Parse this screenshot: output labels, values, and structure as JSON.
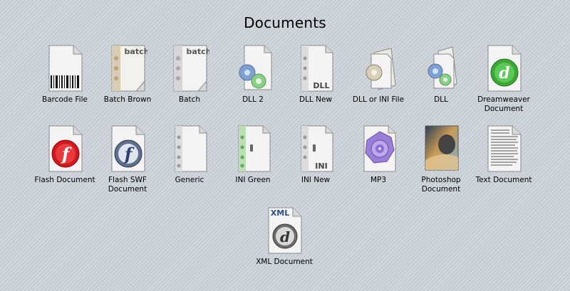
{
  "header": {
    "title": "Documents"
  },
  "icons": [
    {
      "label": "Barcode File",
      "icon": "barcode-file-icon"
    },
    {
      "label": "Batch Brown",
      "icon": "batch-brown-icon",
      "badge": "batch"
    },
    {
      "label": "Batch",
      "icon": "batch-icon",
      "badge": "batch"
    },
    {
      "label": "DLL 2",
      "icon": "dll2-icon"
    },
    {
      "label": "DLL New",
      "icon": "dll-new-icon",
      "badge": "DLL"
    },
    {
      "label": "DLL or INI File",
      "icon": "dll-or-ini-icon"
    },
    {
      "label": "DLL",
      "icon": "dll-icon"
    },
    {
      "label": "Dreamweaver\nDocument",
      "icon": "dreamweaver-icon"
    },
    {
      "label": "Flash Document",
      "icon": "flash-document-icon"
    },
    {
      "label": "Flash SWF\nDocument",
      "icon": "flash-swf-icon"
    },
    {
      "label": "Generic",
      "icon": "generic-icon"
    },
    {
      "label": "INI Green",
      "icon": "ini-green-icon"
    },
    {
      "label": "INI New",
      "icon": "ini-new-icon",
      "badge": "INI"
    },
    {
      "label": "MP3",
      "icon": "mp3-icon"
    },
    {
      "label": "Photoshop\nDocument",
      "icon": "photoshop-icon"
    },
    {
      "label": "Text Document",
      "icon": "text-document-icon"
    },
    {
      "label": "XML Document",
      "icon": "xml-document-icon",
      "badge": "XML"
    }
  ],
  "colors": {
    "paper": "#f4f4f4",
    "fold": "#d9d9d9",
    "gear_blue": "#7fa0d0",
    "gear_green": "#8ccf8a",
    "dreamweaver_green": "#3aa835",
    "flash_red": "#d2181c",
    "mp3_purple": "#9b7fd6"
  }
}
